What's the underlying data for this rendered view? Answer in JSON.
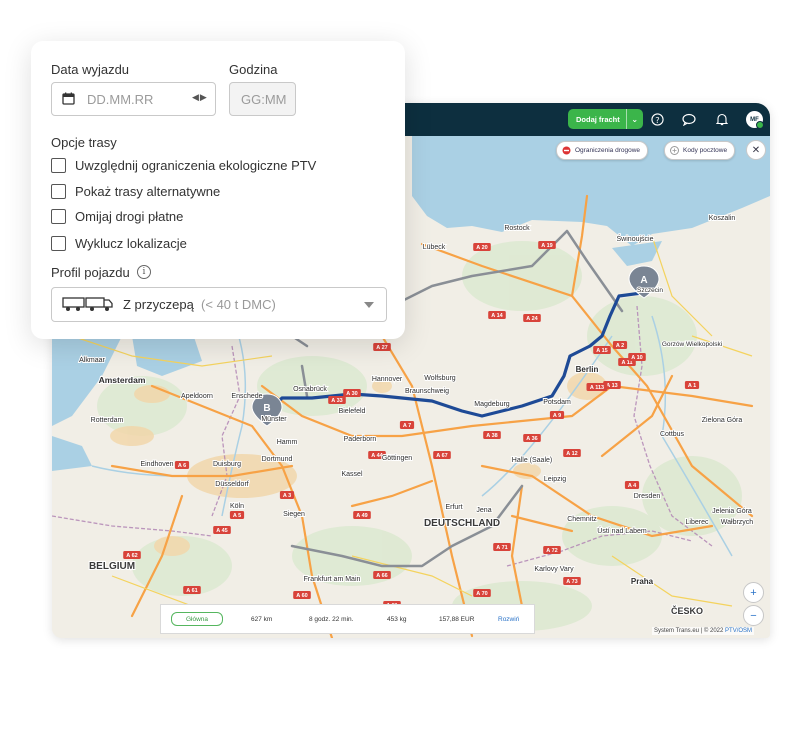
{
  "form": {
    "departure_date_label": "Data wyjazdu",
    "departure_date_placeholder": "DD.MM.RR",
    "time_label": "Godzina",
    "time_placeholder": "GG:MM",
    "route_options_label": "Opcje trasy",
    "options": [
      {
        "label": "Uwzględnij ograniczenia ekologiczne PTV",
        "checked": false
      },
      {
        "label": "Pokaż trasy alternatywne",
        "checked": false
      },
      {
        "label": "Omijaj drogi płatne",
        "checked": false
      },
      {
        "label": "Wyklucz lokalizacje",
        "checked": false
      }
    ],
    "vehicle_profile_label": "Profil pojazdu",
    "vehicle_value": "Z przyczepą",
    "vehicle_sub": "(< 40 t DMC)"
  },
  "topbar": {
    "add_freight": "Dodaj fracht",
    "avatar_initials": "MF",
    "icons": [
      "help-icon",
      "chat-icon",
      "bell-icon"
    ]
  },
  "map": {
    "chips": {
      "road_restrictions": "Ograniczenia drogowe",
      "postal_codes": "Kody pocztowe"
    },
    "markers": {
      "start": "A",
      "end": "B"
    },
    "cities": [
      "Rostock",
      "Świnoujście",
      "Koszalin",
      "Lübeck",
      "Szczecin",
      "Gorzów Wielkopolski",
      "Berlin",
      "Alkmaar",
      "Amsterdam",
      "Apeldoorn",
      "Enschede",
      "Osnabrück",
      "Hannover",
      "Wolfsburg",
      "Braunschweig",
      "Magdeburg",
      "Münster",
      "Bielefeld",
      "Paderborn",
      "Potsdam",
      "Cottbus",
      "Zielona Góra",
      "Rotterdam",
      "Eindhoven",
      "Dortmund",
      "Hamm",
      "Duisburg",
      "Düsseldorf",
      "Göttingen",
      "Halle (Saale)",
      "Leipzig",
      "Dresden",
      "DEUTSCHLAND",
      "Liberec",
      "Wałbrzych",
      "Jelenia Góra",
      "BELGIUM",
      "Köln",
      "Siegen",
      "Erfurt",
      "Jena",
      "Chemnitz",
      "Ústí nad Labem",
      "Frankfurt am Main",
      "Karlovy Vary",
      "Praha",
      "ČESKO",
      "Kassel"
    ],
    "roads": [
      "A 20",
      "A 19",
      "A 24",
      "A 14",
      "A 11",
      "A 10",
      "A 7",
      "A 2",
      "A 1",
      "A 30",
      "A 33",
      "A 44",
      "A 38",
      "A 9",
      "A 4",
      "A 45",
      "A 5",
      "A 3",
      "A 13",
      "A 12",
      "A 15",
      "A 113",
      "A 27",
      "A 71",
      "A 72",
      "A 73",
      "A 66",
      "A 60",
      "A 61",
      "A 70",
      "A 6",
      "A 49",
      "A 36",
      "A 62",
      "A 81",
      "A 67"
    ],
    "summary": {
      "route_label": "Główna",
      "distance": "627 km",
      "duration": "8 godz. 22 min.",
      "weight": "453 kg",
      "cost": "157,88 EUR",
      "expand": "Rozwiń"
    },
    "copyright": "System Trans.eu | © 2022",
    "copyright_link": "PTV/OSM",
    "zoom_in": "+",
    "zoom_out": "−"
  },
  "colors": {
    "topbar": "#0d2f3f",
    "accent_green": "#3bb54a",
    "route": "#1e4a96",
    "alt_route": "#8a8f96",
    "map_land": "#f1eee6",
    "water": "#aad0e4"
  }
}
